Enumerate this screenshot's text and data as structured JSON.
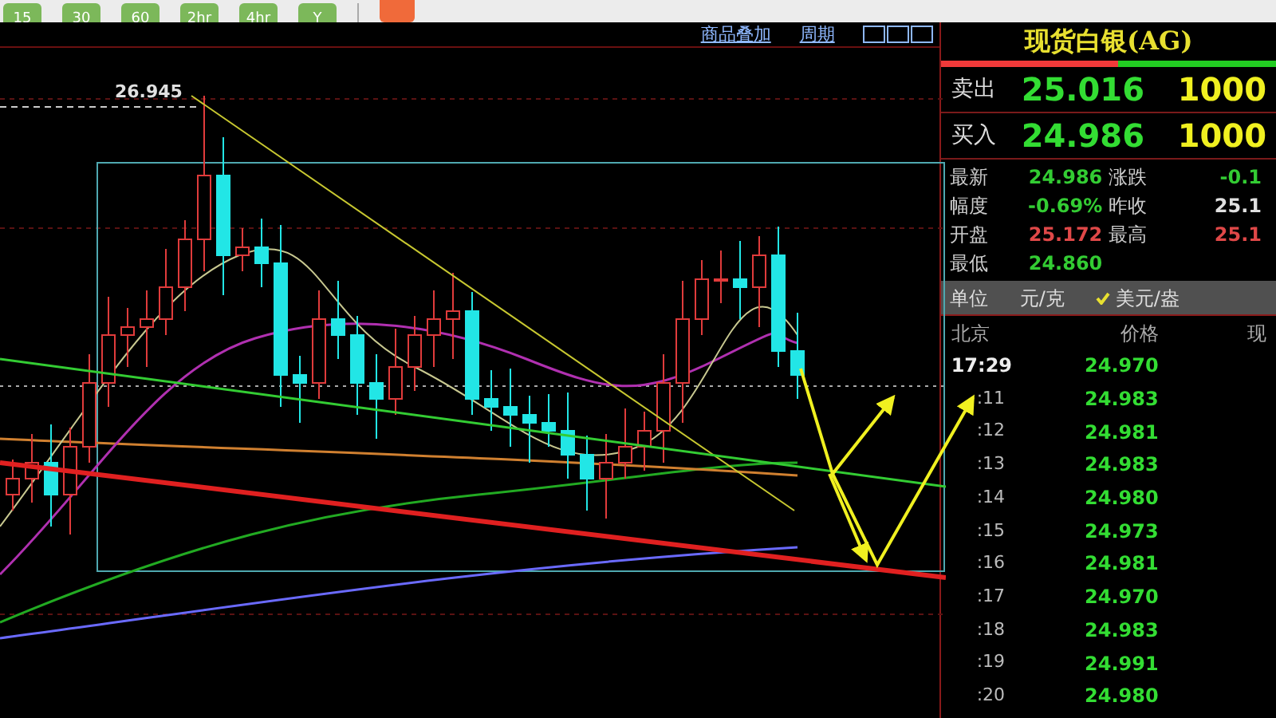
{
  "toolbar": {
    "buttons": [
      {
        "label": "15"
      },
      {
        "label": "30"
      },
      {
        "label": "60"
      },
      {
        "label": "2hr"
      },
      {
        "label": "4hr"
      },
      {
        "label": "Y"
      }
    ]
  },
  "chart": {
    "links": [
      "商品叠加",
      "周期"
    ],
    "peak_label": "26.945"
  },
  "quote": {
    "title": "现货白银(AG)",
    "ratio_bar": {
      "level": 0.53
    },
    "ask": {
      "label": "卖出",
      "price": "25.016",
      "volume": "1000"
    },
    "bid": {
      "label": "买入",
      "price": "24.986",
      "volume": "1000"
    },
    "stats": [
      {
        "label": "最新",
        "value": "24.986",
        "color": "#33cc33"
      },
      {
        "label": "涨跌",
        "value": "-0.1",
        "color": "#33cc33"
      },
      {
        "label": "幅度",
        "value": "-0.69%",
        "color": "#33cc33"
      },
      {
        "label": "昨收",
        "value": "25.1",
        "color": "#e0e0e0"
      },
      {
        "label": "开盘",
        "value": "25.172",
        "color": "#e04848"
      },
      {
        "label": "最高",
        "value": "25.1",
        "color": "#e04848"
      },
      {
        "label": "最低",
        "value": "24.860",
        "color": "#33cc33"
      }
    ],
    "units": {
      "label": "单位",
      "options": [
        {
          "label": "元/克",
          "selected": false
        },
        {
          "label": "美元/盎",
          "selected": true
        }
      ]
    },
    "ticks": {
      "columns": [
        "北京",
        "价格",
        "现"
      ],
      "rows": [
        {
          "time": "17:29",
          "price": "24.970"
        },
        {
          "time": ":11",
          "price": "24.983"
        },
        {
          "time": ":12",
          "price": "24.981"
        },
        {
          "time": ":13",
          "price": "24.983"
        },
        {
          "time": ":14",
          "price": "24.980"
        },
        {
          "time": ":15",
          "price": "24.973"
        },
        {
          "time": ":16",
          "price": "24.981"
        },
        {
          "time": ":17",
          "price": "24.970"
        },
        {
          "time": ":18",
          "price": "24.983"
        },
        {
          "time": ":19",
          "price": "24.991"
        },
        {
          "time": ":20",
          "price": "24.980"
        }
      ]
    }
  }
}
